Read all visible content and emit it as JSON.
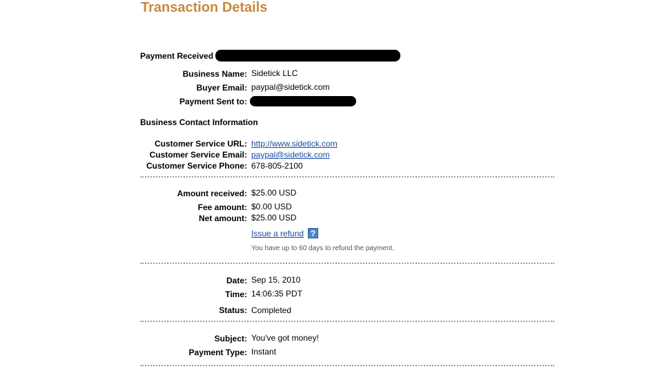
{
  "page_title": "Transaction Details",
  "payment_received_label": "Payment Received",
  "business": {
    "name_label": "Business Name:",
    "name_value": "Sidetick LLC",
    "buyer_email_label": "Buyer Email:",
    "buyer_email_value": "paypal@sidetick.com",
    "payment_sent_to_label": "Payment Sent to:"
  },
  "contact": {
    "heading": "Business Contact Information",
    "url_label": "Customer Service URL:",
    "url_value": "http://www.sidetick.com",
    "email_label": "Customer Service Email:",
    "email_value": "paypal@sidetick.com",
    "phone_label": "Customer Service Phone:",
    "phone_value": "678-805-2100"
  },
  "amounts": {
    "received_label": "Amount received:",
    "received_value": "$25.00 USD",
    "fee_label": "Fee amount:",
    "fee_value": "$0.00 USD",
    "net_label": "Net amount:",
    "net_value": "$25.00 USD",
    "refund_link": "Issue a refund",
    "help_icon_glyph": "?",
    "refund_note": "You have up to 60 days to refund the payment."
  },
  "status_info": {
    "date_label": "Date:",
    "date_value": "Sep 15, 2010",
    "time_label": "Time:",
    "time_value": "14:06:35 PDT",
    "status_label": "Status:",
    "status_value": "Completed"
  },
  "message": {
    "subject_label": "Subject:",
    "subject_value": "You've got money!",
    "type_label": "Payment Type:",
    "type_value": "Instant"
  },
  "colors": {
    "title": "#c88a3c",
    "link": "#1a4a9c",
    "divider": "#999999",
    "help_icon": "#4a86c6"
  }
}
